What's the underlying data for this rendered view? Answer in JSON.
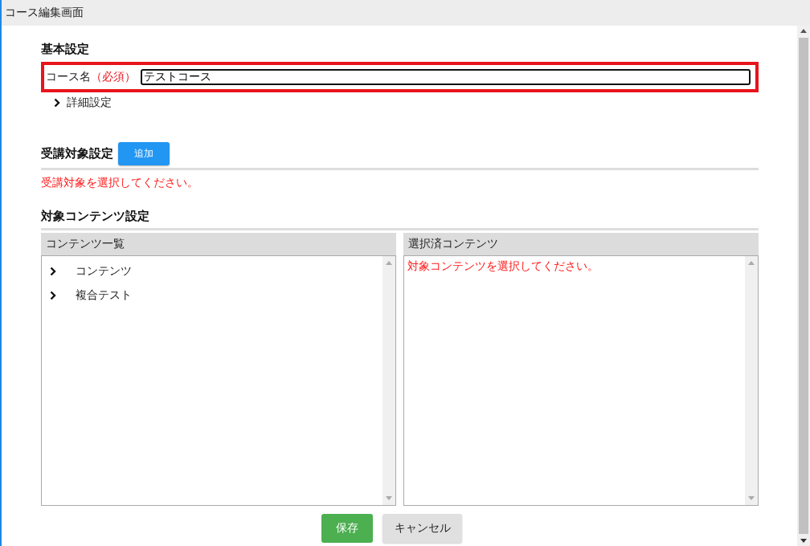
{
  "window": {
    "title": "コース編集画面"
  },
  "basic": {
    "heading": "基本設定",
    "name_label": "コース名",
    "required_mark": "（必須）",
    "name_value": "テストコース",
    "details": {
      "label": "詳細設定",
      "expanded": false
    }
  },
  "audience": {
    "heading": "受講対象設定",
    "add_button": "追加",
    "error": "受講対象を選択してください。"
  },
  "contents": {
    "heading": "対象コンテンツ設定",
    "list": {
      "title": "コンテンツ一覧",
      "items": [
        {
          "label": "コンテンツ",
          "expanded": false
        },
        {
          "label": "複合テスト",
          "expanded": false
        }
      ]
    },
    "selected": {
      "title": "選択済コンテンツ",
      "message": "対象コンテンツを選択してください。"
    }
  },
  "buttons": [
    {
      "label": "保存",
      "kind": "primary"
    },
    {
      "label": "キャンセル",
      "kind": "secondary"
    }
  ]
}
